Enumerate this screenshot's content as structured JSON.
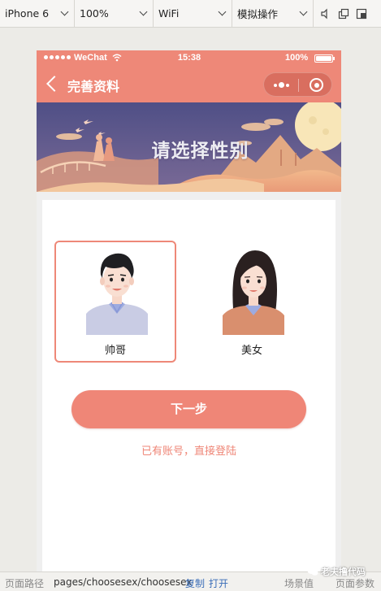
{
  "devtools": {
    "device": "iPhone 6",
    "zoom": "100%",
    "network": "WiFi",
    "simulate": "模拟操作"
  },
  "statusbar": {
    "carrier": "WeChat",
    "time": "15:38",
    "battery": "100%"
  },
  "navbar": {
    "title": "完善资料"
  },
  "banner": {
    "title": "请选择性别"
  },
  "gender_options": [
    {
      "label": "帅哥",
      "selected": true
    },
    {
      "label": "美女",
      "selected": false
    }
  ],
  "actions": {
    "next_label": "下一步",
    "login_link": "已有账号，直接登陆"
  },
  "bottombar": {
    "path_label": "页面路径",
    "path": "pages/choosesex/choosesex",
    "copy": "复制",
    "open": "打开",
    "scene": "场景值",
    "params": "页面参数"
  },
  "watermark": "老夫撸代码",
  "colors": {
    "accent": "#ee8878",
    "button": "#ef8677",
    "banner_sky": "#5c5b8e"
  }
}
